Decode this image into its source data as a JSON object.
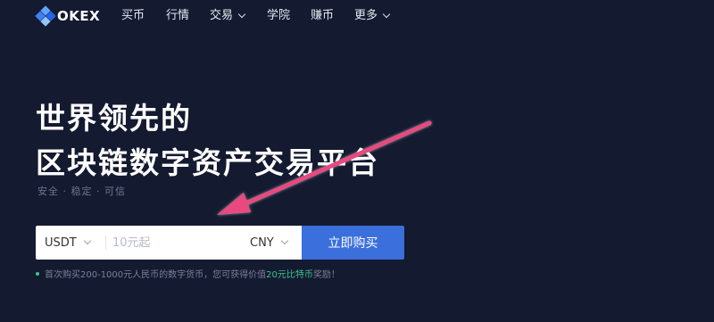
{
  "brand": {
    "name": "OKEX"
  },
  "nav": [
    {
      "label": "买币",
      "dropdown": false
    },
    {
      "label": "行情",
      "dropdown": false
    },
    {
      "label": "交易",
      "dropdown": true
    },
    {
      "label": "学院",
      "dropdown": false
    },
    {
      "label": "赚币",
      "dropdown": false
    },
    {
      "label": "更多",
      "dropdown": true
    }
  ],
  "hero": {
    "title_line1": "世界领先的",
    "title_line2": "区块链数字资产交易平台",
    "subtitle": "安全 · 稳定 · 可信"
  },
  "form": {
    "coin": "USDT",
    "amount_placeholder": "10元起",
    "fiat": "CNY",
    "buy_label": "立即购买"
  },
  "promo": {
    "text": "首次购买200-1000元人民币的数字货币，您可获得价值",
    "highlight": "20元比特币",
    "suffix": "奖励！"
  },
  "colors": {
    "background": "#141a30",
    "accent": "#3a6fdc",
    "highlight": "#3ec48a",
    "arrow": "#e84a7f"
  }
}
